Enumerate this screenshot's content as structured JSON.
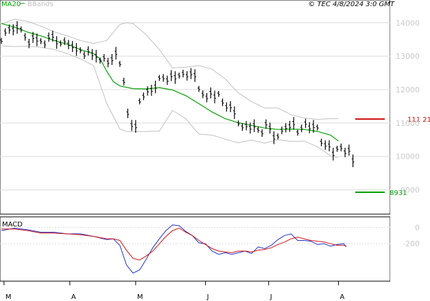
{
  "header": {
    "legend_ma": "MA20",
    "legend_bb": "BBands",
    "copyright": "© TEC 4/8/2024 3:0 GMT"
  },
  "colors": {
    "ma20": "#00a000",
    "bbands": "#c0c0c0",
    "candles": "#000000",
    "resistance": "#d01010",
    "support": "#00a000",
    "macd_line": "#1f2fd0",
    "signal_line": "#d01010",
    "grid": "#dcdcdc"
  },
  "chart_data": [
    {
      "type": "line",
      "title": "",
      "subtitle": "",
      "x": [
        "M",
        "A",
        "M",
        "J",
        "J",
        "A"
      ],
      "ylim": [
        8500,
        14600
      ],
      "yticks": [
        9000,
        10000,
        11000,
        12000,
        13000,
        14000
      ],
      "ytick_labels": [
        "9000",
        "10000",
        "11000",
        "12000",
        "13000",
        "14000"
      ],
      "grid": true,
      "series": [
        {
          "name": "MA20",
          "x": [
            0,
            10,
            20,
            30,
            40,
            50,
            60,
            70,
            75,
            80,
            85,
            90,
            100,
            110,
            120,
            130,
            140,
            150,
            160,
            170,
            180,
            190,
            200,
            210,
            220,
            230,
            240,
            250,
            256
          ],
          "values": [
            13980,
            13870,
            13720,
            13610,
            13470,
            13360,
            13200,
            13080,
            12920,
            12550,
            12240,
            12110,
            12030,
            12020,
            12060,
            11990,
            11820,
            11580,
            11330,
            11130,
            11010,
            10930,
            10850,
            10810,
            10820,
            10810,
            10750,
            10640,
            10460
          ]
        },
        {
          "name": "BBands upper",
          "x": [
            0,
            10,
            20,
            30,
            40,
            50,
            60,
            70,
            80,
            90,
            95,
            100,
            110,
            120,
            130,
            140,
            150,
            160,
            170,
            180,
            190,
            200,
            210,
            220,
            230,
            240,
            250,
            256
          ],
          "values": [
            13960,
            14110,
            14040,
            13900,
            13730,
            13610,
            13470,
            13380,
            13470,
            13950,
            14000,
            13980,
            13640,
            13200,
            12650,
            12670,
            12720,
            12610,
            12320,
            11900,
            11640,
            11450,
            11450,
            11250,
            11150,
            11110,
            11130,
            11130
          ]
        },
        {
          "name": "BBands lower",
          "x": [
            0,
            10,
            20,
            30,
            40,
            50,
            60,
            70,
            80,
            90,
            95,
            100,
            110,
            120,
            130,
            140,
            150,
            160,
            170,
            180,
            190,
            200,
            210,
            220,
            230,
            240,
            250,
            256
          ],
          "values": [
            13310,
            13290,
            13300,
            13270,
            13200,
            13080,
            12920,
            12720,
            11590,
            10820,
            10750,
            10740,
            10750,
            10760,
            11380,
            11130,
            10670,
            10640,
            10520,
            10410,
            10490,
            10400,
            10500,
            10450,
            10460,
            10290,
            10020,
            9960
          ]
        }
      ],
      "candles": [
        {
          "x": 0,
          "v": 13460
        },
        {
          "x": 3,
          "v": 13720
        },
        {
          "x": 6,
          "v": 13810
        },
        {
          "x": 9,
          "v": 13790
        },
        {
          "x": 12,
          "v": 13860
        },
        {
          "x": 15,
          "v": 13800
        },
        {
          "x": 18,
          "v": 13580
        },
        {
          "x": 21,
          "v": 13380
        },
        {
          "x": 24,
          "v": 13560
        },
        {
          "x": 27,
          "v": 13490
        },
        {
          "x": 30,
          "v": 13450
        },
        {
          "x": 33,
          "v": 13360
        },
        {
          "x": 36,
          "v": 13570
        },
        {
          "x": 39,
          "v": 13600
        },
        {
          "x": 42,
          "v": 13410
        },
        {
          "x": 45,
          "v": 13380
        },
        {
          "x": 48,
          "v": 13450
        },
        {
          "x": 51,
          "v": 13350
        },
        {
          "x": 54,
          "v": 13290
        },
        {
          "x": 57,
          "v": 13200
        },
        {
          "x": 60,
          "v": 13180
        },
        {
          "x": 63,
          "v": 13030
        },
        {
          "x": 66,
          "v": 13160
        },
        {
          "x": 69,
          "v": 13050
        },
        {
          "x": 72,
          "v": 13000
        },
        {
          "x": 75,
          "v": 12870
        },
        {
          "x": 78,
          "v": 12950
        },
        {
          "x": 81,
          "v": 12810
        },
        {
          "x": 84,
          "v": 12900
        },
        {
          "x": 87,
          "v": 13090
        },
        {
          "x": 90,
          "v": 12770
        },
        {
          "x": 93,
          "v": 12240
        },
        {
          "x": 96,
          "v": 11290
        },
        {
          "x": 99,
          "v": 10930
        },
        {
          "x": 102,
          "v": 10900
        },
        {
          "x": 105,
          "v": 11650
        },
        {
          "x": 108,
          "v": 11800
        },
        {
          "x": 111,
          "v": 11960
        },
        {
          "x": 114,
          "v": 11980
        },
        {
          "x": 117,
          "v": 12080
        },
        {
          "x": 120,
          "v": 12350
        },
        {
          "x": 123,
          "v": 12350
        },
        {
          "x": 126,
          "v": 12280
        },
        {
          "x": 129,
          "v": 12420
        },
        {
          "x": 132,
          "v": 12360
        },
        {
          "x": 135,
          "v": 12420
        },
        {
          "x": 138,
          "v": 12480
        },
        {
          "x": 141,
          "v": 12410
        },
        {
          "x": 144,
          "v": 12480
        },
        {
          "x": 147,
          "v": 12420
        },
        {
          "x": 150,
          "v": 12020
        },
        {
          "x": 153,
          "v": 11860
        },
        {
          "x": 156,
          "v": 11760
        },
        {
          "x": 159,
          "v": 11900
        },
        {
          "x": 162,
          "v": 11780
        },
        {
          "x": 165,
          "v": 11870
        },
        {
          "x": 168,
          "v": 11620
        },
        {
          "x": 171,
          "v": 11480
        },
        {
          "x": 174,
          "v": 11490
        },
        {
          "x": 177,
          "v": 11310
        },
        {
          "x": 180,
          "v": 10990
        },
        {
          "x": 183,
          "v": 10880
        },
        {
          "x": 186,
          "v": 10920
        },
        {
          "x": 189,
          "v": 10850
        },
        {
          "x": 192,
          "v": 10920
        },
        {
          "x": 195,
          "v": 10800
        },
        {
          "x": 198,
          "v": 10700
        },
        {
          "x": 201,
          "v": 10970
        },
        {
          "x": 204,
          "v": 10850
        },
        {
          "x": 207,
          "v": 10560
        },
        {
          "x": 210,
          "v": 10600
        },
        {
          "x": 213,
          "v": 10780
        },
        {
          "x": 216,
          "v": 10860
        },
        {
          "x": 219,
          "v": 10900
        },
        {
          "x": 222,
          "v": 10990
        },
        {
          "x": 225,
          "v": 10710
        },
        {
          "x": 228,
          "v": 10840
        },
        {
          "x": 231,
          "v": 10990
        },
        {
          "x": 234,
          "v": 10860
        },
        {
          "x": 237,
          "v": 10900
        },
        {
          "x": 240,
          "v": 10870
        },
        {
          "x": 243,
          "v": 10420
        },
        {
          "x": 246,
          "v": 10340
        },
        {
          "x": 249,
          "v": 10320
        },
        {
          "x": 252,
          "v": 10070
        },
        {
          "x": 255,
          "v": 10230
        },
        {
          "x": 258,
          "v": 10270
        },
        {
          "x": 261,
          "v": 10120
        },
        {
          "x": 264,
          "v": 10190
        },
        {
          "x": 267,
          "v": 9870
        }
      ],
      "levels": [
        {
          "name": "resistance",
          "value": 11121,
          "label": "111 21"
        },
        {
          "name": "support",
          "value": 8931,
          "label": "8931"
        }
      ]
    },
    {
      "type": "line",
      "title": "MACD",
      "x": [
        "M",
        "A",
        "M",
        "J",
        "J",
        "A"
      ],
      "ylim": [
        -650,
        120
      ],
      "yticks": [
        0,
        -200
      ],
      "ytick_labels": [
        "0",
        "-200"
      ],
      "series": [
        {
          "name": "MACD",
          "x": [
            0,
            10,
            20,
            30,
            40,
            50,
            60,
            70,
            80,
            85,
            90,
            95,
            100,
            105,
            110,
            115,
            120,
            125,
            130,
            135,
            140,
            145,
            150,
            155,
            160,
            165,
            170,
            175,
            180,
            185,
            190,
            195,
            200,
            205,
            210,
            215,
            220,
            225,
            230,
            235,
            240,
            245,
            250,
            255,
            260,
            262
          ],
          "values": [
            -40,
            -10,
            -30,
            -60,
            -60,
            -80,
            -80,
            -110,
            -150,
            -140,
            -220,
            -460,
            -560,
            -520,
            -390,
            -250,
            -140,
            -40,
            30,
            20,
            -50,
            -100,
            -190,
            -200,
            -290,
            -330,
            -310,
            -330,
            -310,
            -290,
            -320,
            -240,
            -260,
            -220,
            -150,
            -100,
            -80,
            -160,
            -160,
            -170,
            -210,
            -200,
            -230,
            -210,
            -200,
            -240
          ]
        },
        {
          "name": "Signal",
          "x": [
            0,
            10,
            20,
            30,
            40,
            50,
            60,
            70,
            80,
            85,
            90,
            95,
            100,
            105,
            110,
            115,
            120,
            125,
            130,
            135,
            140,
            145,
            150,
            155,
            160,
            165,
            170,
            175,
            180,
            185,
            190,
            195,
            200,
            205,
            210,
            215,
            220,
            225,
            230,
            235,
            240,
            245,
            250,
            255,
            260,
            262
          ],
          "values": [
            -20,
            -20,
            -40,
            -70,
            -70,
            -80,
            -90,
            -110,
            -140,
            -140,
            -160,
            -280,
            -380,
            -400,
            -350,
            -290,
            -200,
            -110,
            -40,
            -10,
            -60,
            -100,
            -160,
            -210,
            -260,
            -290,
            -300,
            -310,
            -290,
            -290,
            -300,
            -280,
            -270,
            -250,
            -210,
            -180,
            -140,
            -120,
            -140,
            -160,
            -170,
            -180,
            -200,
            -220,
            -220,
            -230
          ]
        }
      ]
    }
  ]
}
